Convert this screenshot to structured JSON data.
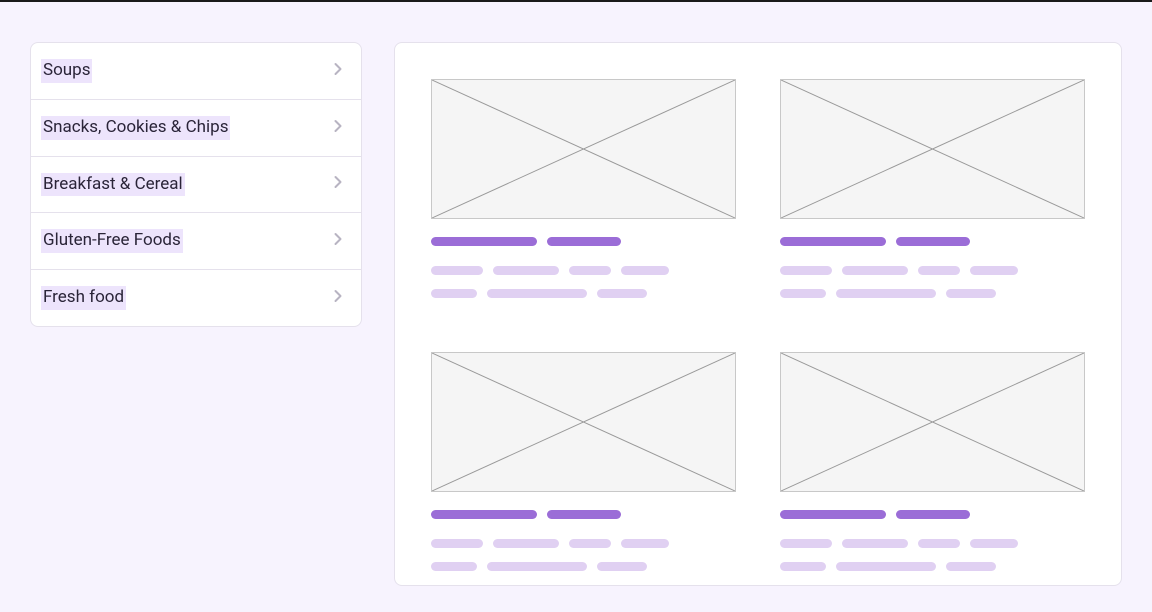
{
  "sidebar": {
    "items": [
      {
        "label": "Soups"
      },
      {
        "label": "Snacks, Cookies & Chips"
      },
      {
        "label": "Breakfast & Cereal"
      },
      {
        "label": "Gluten-Free Foods"
      },
      {
        "label": "Fresh food"
      }
    ]
  },
  "colors": {
    "accent": "#9b6dd7",
    "accentLight": "#e0d0f2",
    "highlight": "#ede4fc"
  }
}
